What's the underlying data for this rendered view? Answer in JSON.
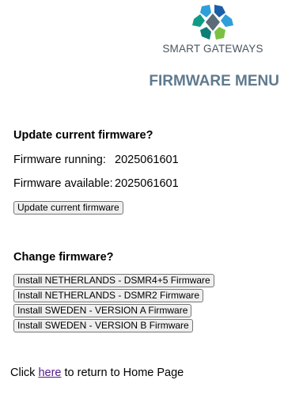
{
  "brand": {
    "name": "SMART GATEWAYS",
    "logo_icon": "diamond-logo-icon",
    "colors": [
      "#2f9fd9",
      "#1c5fa8",
      "#7ac143",
      "#0e9d84",
      "#5c6b78"
    ]
  },
  "page_title": "FIRMWARE MENU",
  "update_section": {
    "heading": "Update current firmware?",
    "running_label": "Firmware running:",
    "running_value": "2025061601",
    "available_label": "Firmware available:",
    "available_value": "2025061601",
    "update_button": "Update current firmware"
  },
  "change_section": {
    "heading": "Change firmware?",
    "buttons": [
      "Install NETHERLANDS - DSMR4+5 Firmware",
      "Install NETHERLANDS - DSMR2 Firmware",
      "Install SWEDEN - VERSION A Firmware",
      "Install SWEDEN - VERSION B Firmware"
    ]
  },
  "footer": {
    "prefix": "Click ",
    "link_text": "here",
    "suffix": " to return to Home Page"
  }
}
